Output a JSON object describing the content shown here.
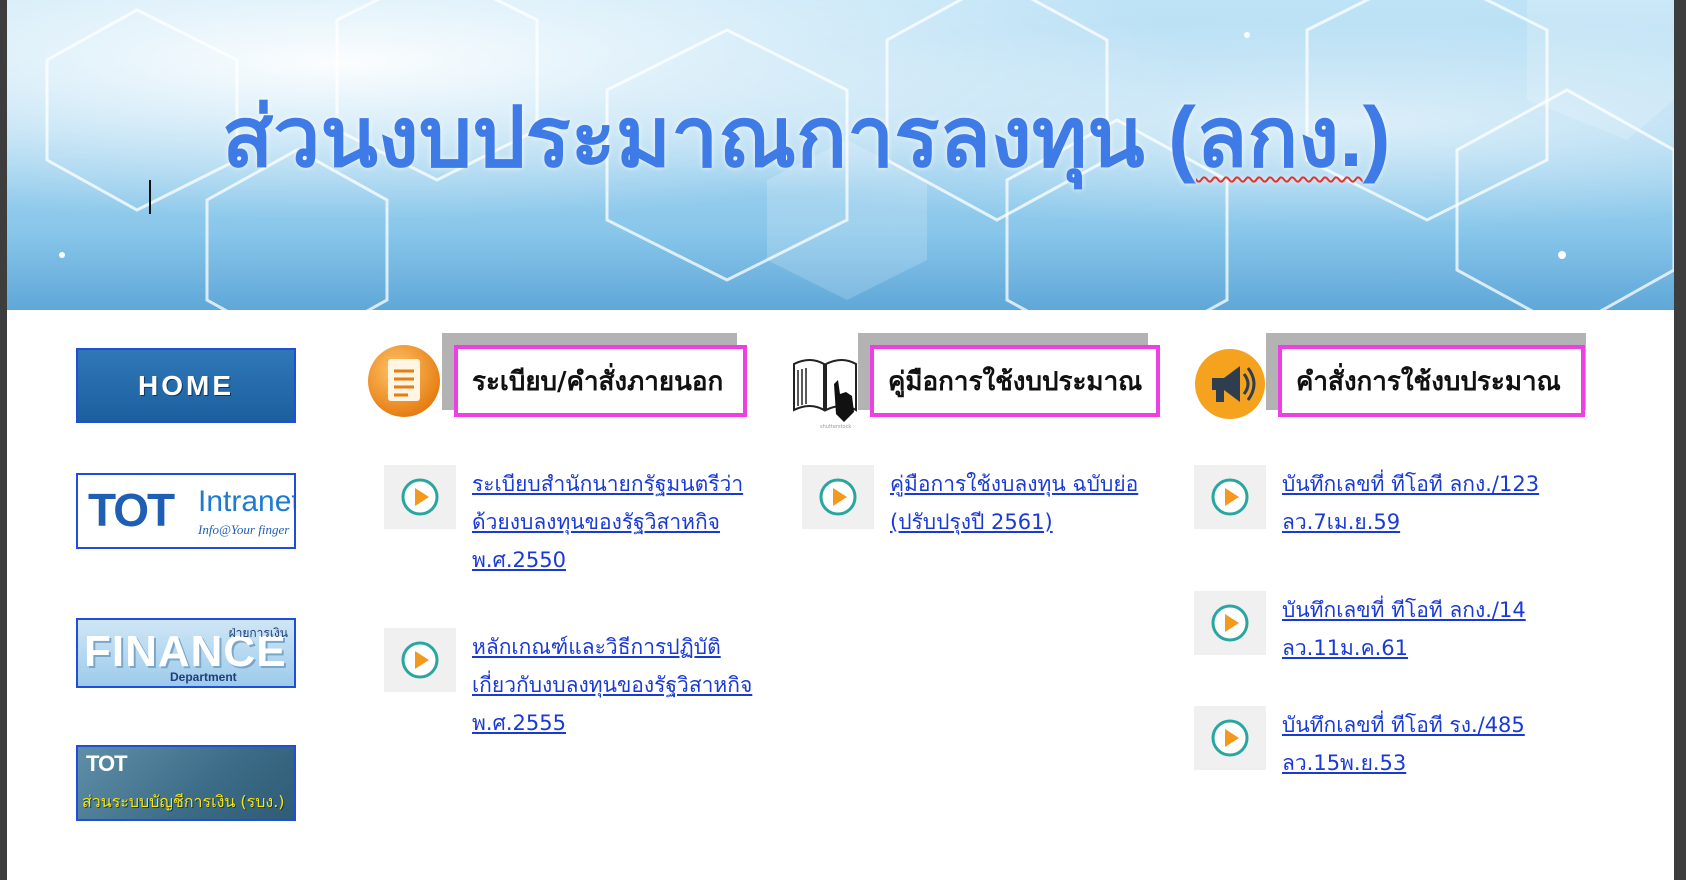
{
  "banner": {
    "title": "ส่วนงบประมาณการลงทุน (",
    "title_underlined": "ลกง.",
    "title_end": ")"
  },
  "sidebar": {
    "home_label": "HOME",
    "intranet": {
      "logo": "TOT",
      "label": "Intranet",
      "tagline": "Info@Your finger"
    },
    "finance": {
      "word": "FINANCE",
      "thai": "ฝ่ายการเงิน",
      "dept": "Department"
    },
    "accounting": {
      "logo": "TOT",
      "label": "ส่วนระบบบัญชีการเงิน (รบง.)"
    }
  },
  "sections": [
    {
      "title": "ระเบียบ/คำสั่งภายนอก",
      "icon": "document-icon",
      "items": [
        {
          "text": "ระเบียบสำนักนายกรัฐมนตรีว่าด้วยงบลงทุนของรัฐวิสาหกิจ พ.ศ.2550"
        },
        {
          "text": "หลักเกณฑ์และวิธีการปฏิบัติเกี่ยวกับงบลงทุนของรัฐวิสาหกิจ พ.ศ.2555"
        }
      ]
    },
    {
      "title": "คู่มือการใช้งบประมาณ",
      "icon": "book-hand-icon",
      "icon_watermark": "shutterstock",
      "items": [
        {
          "text": "คู่มือการใช้งบลงทุน ฉบับย่อ (ปรับปรุงปี 2561)"
        }
      ]
    },
    {
      "title": "คำสั่งการใช้งบประมาณ",
      "icon": "megaphone-icon",
      "items": [
        {
          "text": "บันทึกเลขที่ ทีโอที ลกง./123 ลว.7เม.ย.59"
        },
        {
          "text": "บันทึกเลขที่ ทีโอที ลกง./14 ลว.11ม.ค.61"
        },
        {
          "text": "บันทึกเลขที่ ทีโอที รง./485 ลว.15พ.ย.53"
        }
      ]
    }
  ],
  "colors": {
    "title_blue": "#3f7be6",
    "link_blue": "#1a3ad6",
    "header_border": "#ee3fe4",
    "button_border": "#1f4fd9",
    "play_icon": "#2aa6a0",
    "play_fill": "#f39a1e"
  }
}
